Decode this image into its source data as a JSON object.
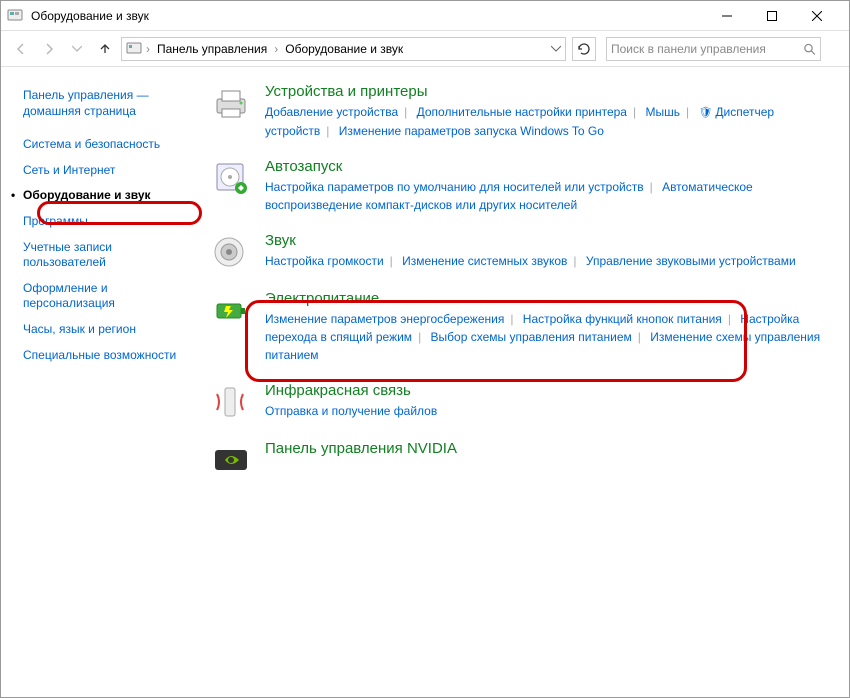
{
  "window": {
    "title": "Оборудование и звук"
  },
  "breadcrumb": [
    "Панель управления",
    "Оборудование и звук"
  ],
  "search": {
    "placeholder": "Поиск в панели управления"
  },
  "sidebar": [
    "Панель управления — домашняя страница",
    "Система и безопасность",
    "Сеть и Интернет",
    "Оборудование и звук",
    "Программы",
    "Учетные записи пользователей",
    "Оформление и персонализация",
    "Часы, язык и регион",
    "Специальные возможности"
  ],
  "categories": [
    {
      "title": "Устройства и принтеры",
      "links": [
        "Добавление устройства",
        "Дополнительные настройки принтера",
        "Мышь",
        "Диспетчер устройств",
        "Изменение параметров запуска Windows To Go"
      ],
      "shield_indices": [
        3
      ]
    },
    {
      "title": "Автозапуск",
      "links": [
        "Настройка параметров по умолчанию для носителей или устройств",
        "Автоматическое воспроизведение компакт-дисков или других носителей"
      ]
    },
    {
      "title": "Звук",
      "links": [
        "Настройка громкости",
        "Изменение системных звуков",
        "Управление звуковыми устройствами"
      ]
    },
    {
      "title": "Электропитание",
      "links": [
        "Изменение параметров энергосбережения",
        "Настройка функций кнопок питания",
        "Настройка перехода в спящий режим",
        "Выбор схемы управления питанием",
        "Изменение схемы управления питанием"
      ]
    },
    {
      "title": "Инфракрасная связь",
      "links": [
        "Отправка и получение файлов"
      ]
    },
    {
      "title": "Панель управления NVIDIA",
      "links": []
    }
  ]
}
